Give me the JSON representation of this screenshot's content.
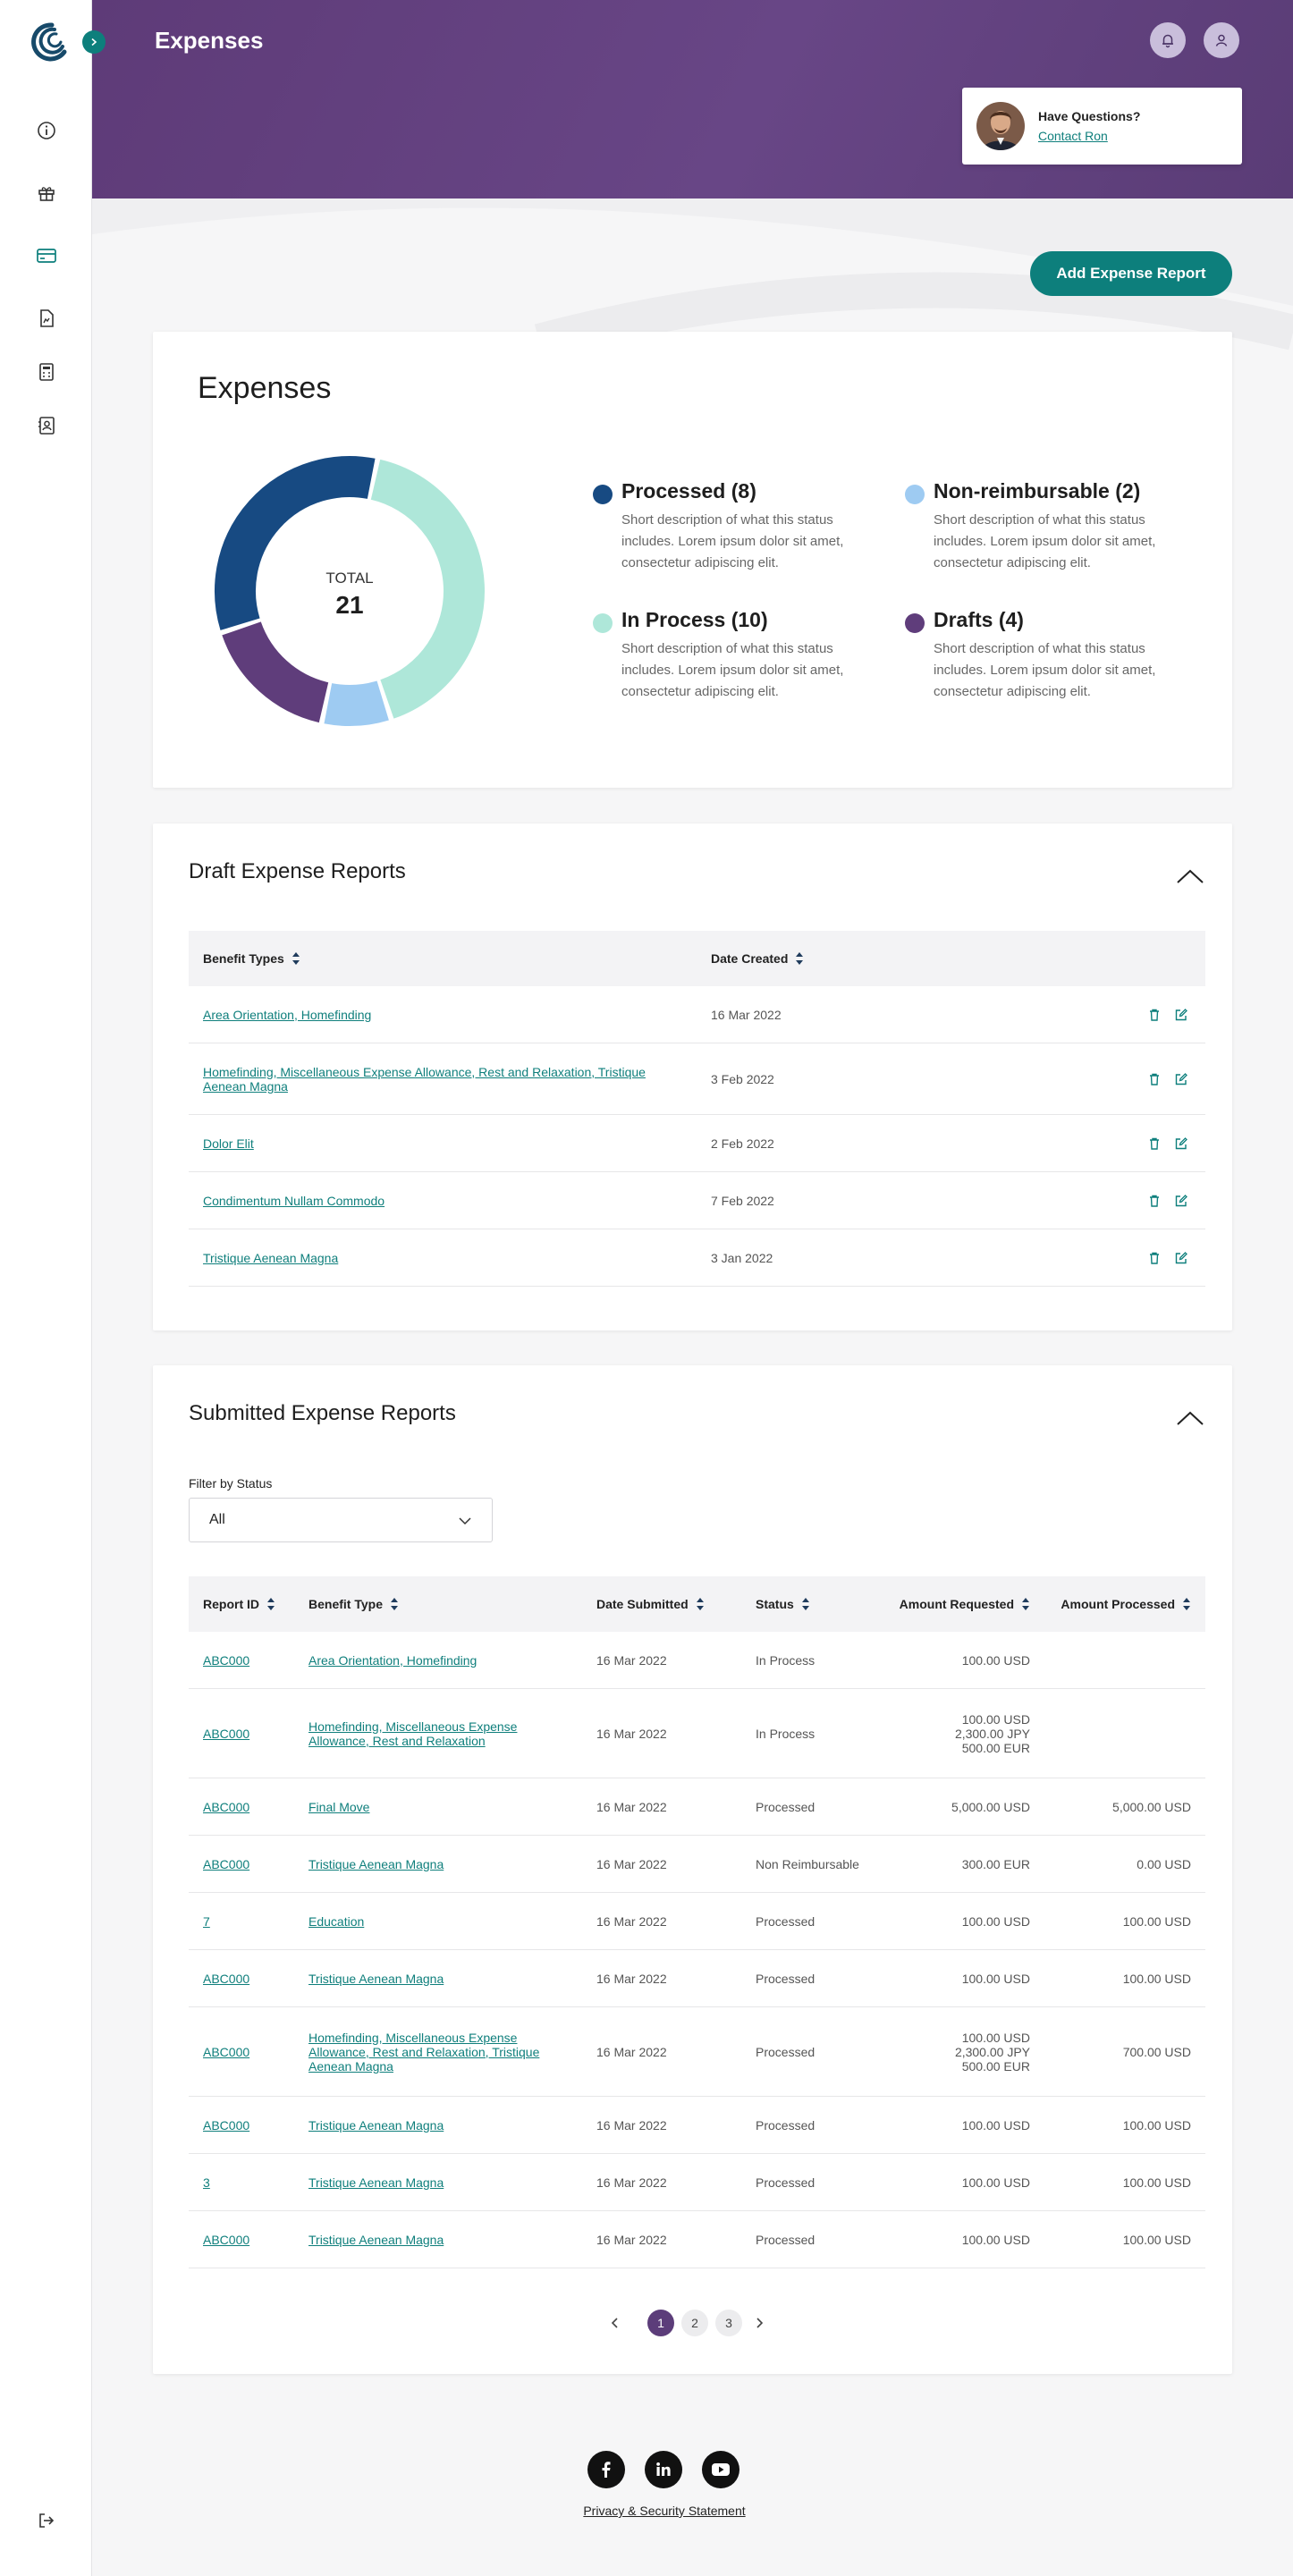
{
  "header": {
    "title": "Expenses",
    "contact": {
      "question": "Have Questions?",
      "link": "Contact Ron"
    }
  },
  "sidebar": {
    "icons": [
      "info-icon",
      "gift-icon",
      "credit-card-icon",
      "document-icon",
      "calculator-icon",
      "contact-card-icon"
    ],
    "active_index": 2
  },
  "add_button_label": "Add Expense Report",
  "expenses": {
    "title": "Expenses",
    "total_label": "TOTAL",
    "total_value": "21",
    "legend": [
      {
        "label": "Processed (8)",
        "color": "#174a82",
        "description": "Short description of what this status includes. Lorem ipsum dolor sit amet, consectetur adipiscing elit."
      },
      {
        "label": "Non-reimbursable (2)",
        "color": "#9ecbf2",
        "description": "Short description of what this status includes. Lorem ipsum dolor sit amet, consectetur adipiscing elit."
      },
      {
        "label": "In Process (10)",
        "color": "#aee7d9",
        "description": "Short description of what this status includes. Lorem ipsum dolor sit amet, consectetur adipiscing elit."
      },
      {
        "label": "Drafts (4)",
        "color": "#5f3d7b",
        "description": "Short description of what this status includes. Lorem ipsum dolor sit amet, consectetur adipiscing elit."
      }
    ]
  },
  "chart_data": {
    "type": "pie",
    "style": "donut",
    "categories": [
      "In Process",
      "Non-reimbursable",
      "Drafts",
      "Processed"
    ],
    "values": [
      10,
      2,
      4,
      8
    ],
    "colors": [
      "#aee7d9",
      "#9ecbf2",
      "#5f3d7b",
      "#174a82"
    ],
    "total": 21
  },
  "draft": {
    "title": "Draft Expense Reports",
    "columns": [
      "Benefit Types",
      "Date Created"
    ],
    "rows": [
      {
        "benefit": "Area Orientation, Homefinding",
        "date": "16 Mar 2022"
      },
      {
        "benefit": "Homefinding, Miscellaneous Expense Allowance, Rest and Relaxation, Tristique Aenean Magna",
        "date": "3 Feb 2022"
      },
      {
        "benefit": "Dolor Elit",
        "date": "2 Feb 2022"
      },
      {
        "benefit": "Condimentum Nullam Commodo",
        "date": "7 Feb 2022"
      },
      {
        "benefit": "Tristique Aenean Magna",
        "date": "3 Jan 2022"
      }
    ]
  },
  "submitted": {
    "title": "Submitted Expense Reports",
    "filter_label": "Filter by Status",
    "filter_value": "All",
    "columns": [
      "Report ID",
      "Benefit Type",
      "Date Submitted",
      "Status",
      "Amount Requested",
      "Amount Processed"
    ],
    "rows": [
      {
        "id": "ABC000",
        "benefit": "Area Orientation, Homefinding",
        "date": "16 Mar 2022",
        "status": "In Process",
        "requested": [
          "100.00 USD"
        ],
        "processed": ""
      },
      {
        "id": "ABC000",
        "benefit": "Homefinding, Miscellaneous Expense Allowance, Rest and Relaxation",
        "date": "16 Mar 2022",
        "status": "In Process",
        "requested": [
          "100.00 USD",
          "2,300.00 JPY",
          "500.00 EUR"
        ],
        "processed": ""
      },
      {
        "id": "ABC000",
        "benefit": "Final Move",
        "date": "16 Mar 2022",
        "status": "Processed",
        "requested": [
          "5,000.00 USD"
        ],
        "processed": "5,000.00 USD"
      },
      {
        "id": "ABC000",
        "benefit": "Tristique Aenean Magna",
        "date": "16 Mar 2022",
        "status": "Non Reimbursable",
        "requested": [
          "300.00 EUR"
        ],
        "processed": "0.00 USD"
      },
      {
        "id": "7",
        "benefit": "Education",
        "date": "16 Mar 2022",
        "status": "Processed",
        "requested": [
          "100.00 USD"
        ],
        "processed": "100.00 USD"
      },
      {
        "id": "ABC000",
        "benefit": "Tristique Aenean Magna",
        "date": "16 Mar 2022",
        "status": "Processed",
        "requested": [
          "100.00 USD"
        ],
        "processed": "100.00 USD"
      },
      {
        "id": "ABC000",
        "benefit": "Homefinding, Miscellaneous Expense Allowance, Rest and Relaxation, Tristique Aenean Magna",
        "date": "16 Mar 2022",
        "status": "Processed",
        "requested": [
          "100.00 USD",
          "2,300.00 JPY",
          "500.00 EUR"
        ],
        "processed": "700.00 USD"
      },
      {
        "id": "ABC000",
        "benefit": "Tristique Aenean Magna",
        "date": "16 Mar 2022",
        "status": "Processed",
        "requested": [
          "100.00 USD"
        ],
        "processed": "100.00 USD"
      },
      {
        "id": "3",
        "benefit": "Tristique Aenean Magna",
        "date": "16 Mar 2022",
        "status": "Processed",
        "requested": [
          "100.00 USD"
        ],
        "processed": "100.00 USD"
      },
      {
        "id": "ABC000",
        "benefit": "Tristique Aenean Magna",
        "date": "16 Mar 2022",
        "status": "Processed",
        "requested": [
          "100.00 USD"
        ],
        "processed": "100.00 USD"
      }
    ],
    "pagination": {
      "pages": [
        "1",
        "2",
        "3"
      ],
      "current": "1"
    }
  },
  "footer": {
    "social": [
      "facebook-icon",
      "linkedin-icon",
      "youtube-icon"
    ],
    "privacy": "Privacy & Security Statement"
  },
  "colors": {
    "brand_purple": "#5e3b78",
    "accent_teal": "#0d7f7c",
    "link_teal": "#0f7f7c"
  }
}
